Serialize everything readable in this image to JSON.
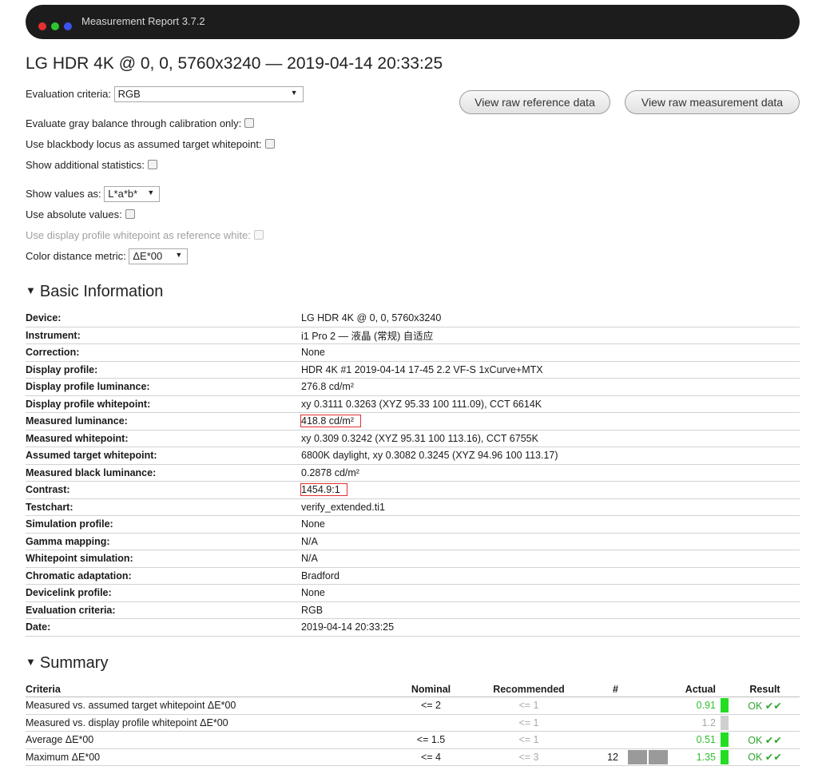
{
  "window": {
    "title": "Measurement Report 3.7.2",
    "dots": {
      "red": "#e63030",
      "green": "#2ec42e",
      "blue": "#3a54f0"
    }
  },
  "report_title": "LG HDR 4K @ 0, 0, 5760x3240 — 2019-04-14 20:33:25",
  "options": {
    "evaluation_criteria_label": "Evaluation criteria:",
    "evaluation_criteria_value": "RGB",
    "gray_balance_label": "Evaluate gray balance through calibration only:",
    "blackbody_label": "Use blackbody locus as assumed target whitepoint:",
    "additional_stats_label": "Show additional statistics:",
    "show_values_label": "Show values as:",
    "show_values_value": "L*a*b*",
    "absolute_values_label": "Use absolute values:",
    "display_whitepoint_label": "Use display profile whitepoint as reference white:",
    "distance_metric_label": "Color distance metric:",
    "distance_metric_value": "ΔE*00"
  },
  "buttons": {
    "raw_reference": "View raw reference data",
    "raw_measurement": "View raw measurement data"
  },
  "basic_info": {
    "title": "Basic Information",
    "rows": [
      {
        "key": "Device:",
        "value": "LG HDR 4K @ 0, 0, 5760x3240"
      },
      {
        "key": "Instrument:",
        "value": "i1 Pro 2 — 液晶 (常规) 自适应"
      },
      {
        "key": "Correction:",
        "value": "None"
      },
      {
        "key": "Display profile:",
        "value": "HDR 4K #1 2019-04-14 17-45 2.2 VF-S 1xCurve+MTX"
      },
      {
        "key": "Display profile luminance:",
        "value": "276.8 cd/m²"
      },
      {
        "key": "Display profile whitepoint:",
        "value": "xy 0.3111 0.3263 (XYZ 95.33 100 111.09), CCT 6614K"
      },
      {
        "key": "Measured luminance:",
        "value": "418.8 cd/m²",
        "highlight": true
      },
      {
        "key": "Measured whitepoint:",
        "value": "xy 0.309 0.3242 (XYZ 95.31 100 113.16), CCT 6755K"
      },
      {
        "key": "Assumed target whitepoint:",
        "value": "6800K daylight, xy 0.3082 0.3245 (XYZ 94.96 100 113.17)"
      },
      {
        "key": "Measured black luminance:",
        "value": "0.2878 cd/m²"
      },
      {
        "key": "Contrast:",
        "value": "1454.9:1",
        "highlight": true
      },
      {
        "key": "Testchart:",
        "value": "verify_extended.ti1"
      },
      {
        "key": "Simulation profile:",
        "value": "None"
      },
      {
        "key": "Gamma mapping:",
        "value": "N/A"
      },
      {
        "key": "Whitepoint simulation:",
        "value": "N/A"
      },
      {
        "key": "Chromatic adaptation:",
        "value": "Bradford"
      },
      {
        "key": "Devicelink profile:",
        "value": "None"
      },
      {
        "key": "Evaluation criteria:",
        "value": "RGB"
      },
      {
        "key": "Date:",
        "value": "2019-04-14 20:33:25"
      }
    ]
  },
  "summary": {
    "title": "Summary",
    "headers": {
      "criteria": "Criteria",
      "nominal": "Nominal",
      "recommended": "Recommended",
      "count": "#",
      "actual": "Actual",
      "result": "Result"
    },
    "rows": [
      {
        "criteria": "Measured vs. assumed target whitepoint ΔE*00",
        "nominal": "<= 2",
        "recommended": "<= 1",
        "count": "",
        "bar_cells": 0,
        "actual": "0.91",
        "actual_color": "green",
        "indicator": "#22dd22",
        "result": "OK ✔✔"
      },
      {
        "criteria": "Measured vs. display profile whitepoint ΔE*00",
        "nominal": "",
        "recommended": "<= 1",
        "count": "",
        "bar_cells": 0,
        "actual": "1.2",
        "actual_color": "grey",
        "indicator": "#cfcfcf",
        "result": ""
      },
      {
        "criteria": "Average ΔE*00",
        "nominal": "<= 1.5",
        "recommended": "<= 1",
        "count": "",
        "bar_cells": 0,
        "actual": "0.51",
        "actual_color": "green",
        "indicator": "#22dd22",
        "result": "OK ✔✔"
      },
      {
        "criteria": "Maximum ΔE*00",
        "nominal": "<= 4",
        "recommended": "<= 3",
        "count": "12",
        "bar_cells": 2,
        "actual": "1.35",
        "actual_color": "green",
        "indicator": "#22dd22",
        "result": "OK ✔✔"
      }
    ]
  }
}
